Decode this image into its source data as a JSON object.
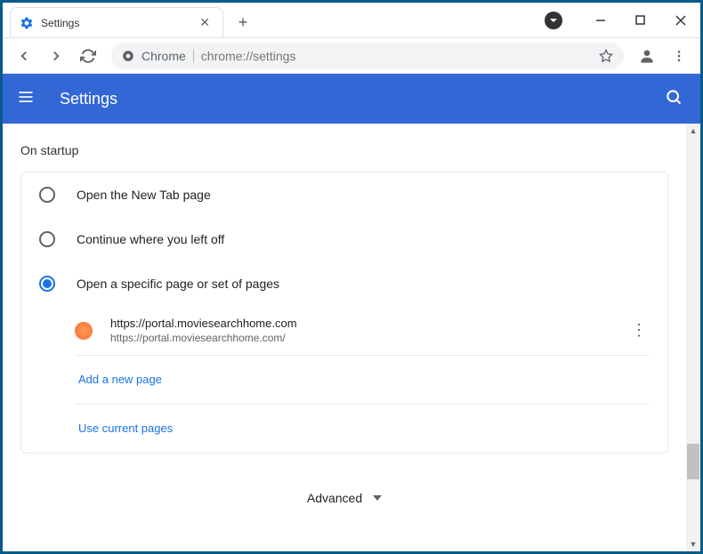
{
  "tab": {
    "title": "Settings"
  },
  "address": {
    "scheme": "Chrome",
    "url": "chrome://settings"
  },
  "header": {
    "title": "Settings"
  },
  "section": {
    "title": "On startup"
  },
  "options": {
    "opt1": "Open the New Tab page",
    "opt2": "Continue where you left off",
    "opt3": "Open a specific page or set of pages"
  },
  "page": {
    "title": "https://portal.moviesearchhome.com",
    "url": "https://portal.moviesearchhome.com/"
  },
  "links": {
    "add": "Add a new page",
    "current": "Use current pages"
  },
  "advanced": "Advanced"
}
